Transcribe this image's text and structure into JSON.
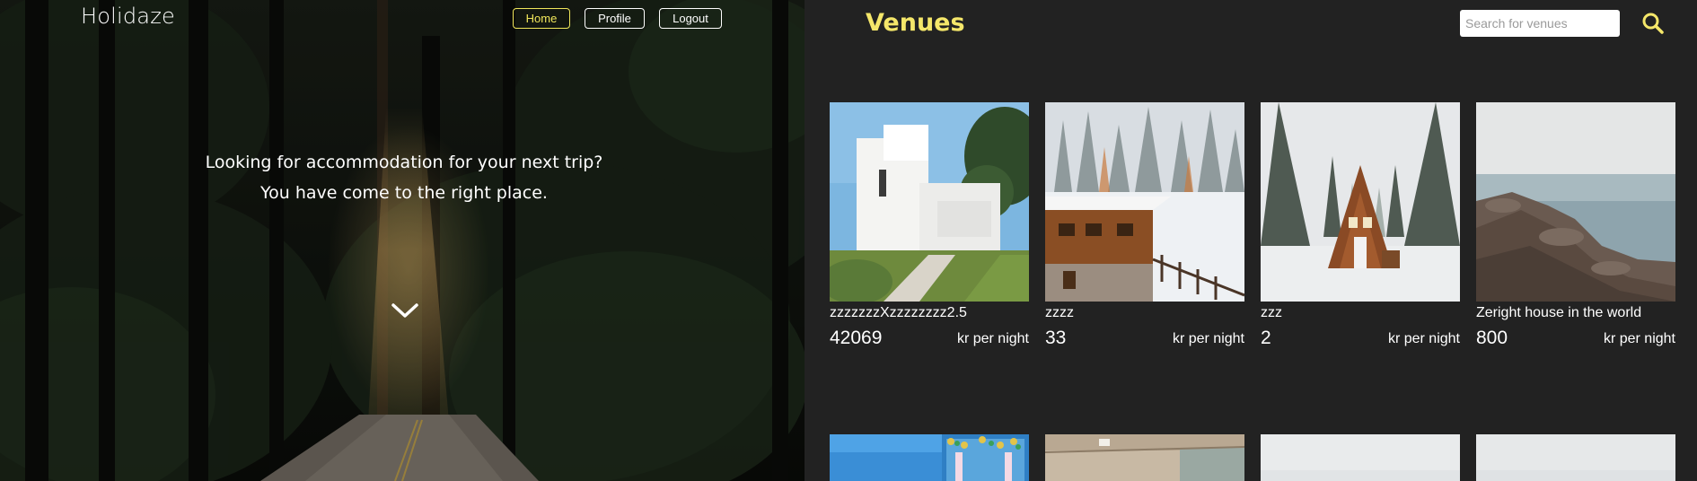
{
  "header": {
    "brand": "Holidaze",
    "nav": [
      {
        "label": "Home",
        "active": true
      },
      {
        "label": "Profile",
        "active": false
      },
      {
        "label": "Logout",
        "active": false
      }
    ]
  },
  "hero": {
    "line1": "Looking for accommodation for your next trip?",
    "line2": "You have come to the right place.",
    "scroll_icon": "chevron-down-icon"
  },
  "venues": {
    "title": "Venues",
    "search": {
      "placeholder": "Search for venues",
      "value": ""
    },
    "search_icon": "search-icon",
    "items": [
      {
        "name": "zzzzzzzXzzzzzzzz2.5",
        "price": "42069",
        "unit": "kr per night"
      },
      {
        "name": "zzzz",
        "price": "33",
        "unit": "kr per night"
      },
      {
        "name": "zzz",
        "price": "2",
        "unit": "kr per night"
      },
      {
        "name": "Zeright house in the world",
        "price": "800",
        "unit": "kr per night"
      }
    ]
  },
  "colors": {
    "accent": "#f5e76a",
    "background": "#222222"
  }
}
